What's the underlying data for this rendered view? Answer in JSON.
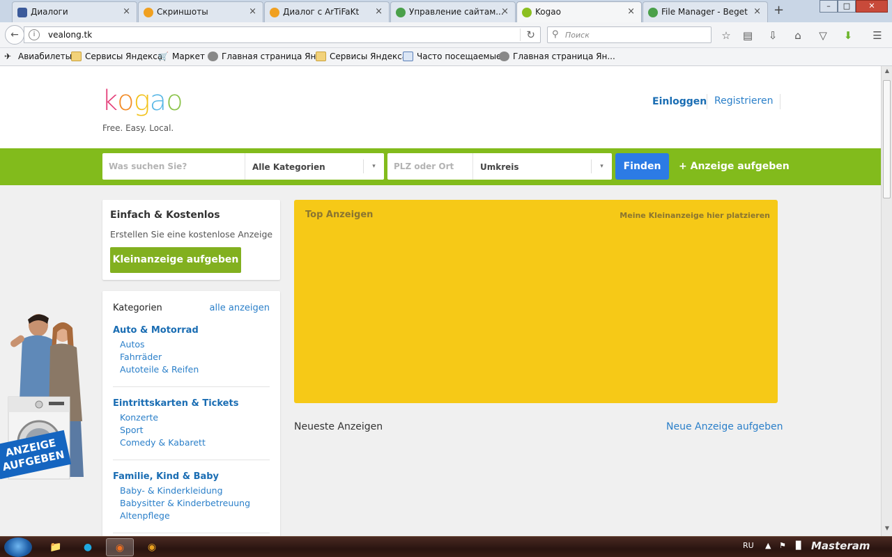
{
  "browser": {
    "tabs": [
      {
        "label": "Диалоги",
        "fav_color": "#3b5a9a",
        "active": false
      },
      {
        "label": "Скриншоты",
        "fav_color": "#f0a020",
        "active": false
      },
      {
        "label": "Диалог с ArTiFaKt",
        "fav_color": "#f0a020",
        "active": false
      },
      {
        "label": "Управление сайтам...",
        "fav_color": "#4aa04a",
        "active": false
      },
      {
        "label": "Kogao",
        "fav_color": "#8bbf20",
        "active": true
      },
      {
        "label": "File Manager - Beget",
        "fav_color": "#4aa04a",
        "active": false
      }
    ],
    "tab_close_glyph": "×",
    "new_tab_glyph": "+",
    "url": "vealong.tk",
    "search_placeholder": "Поиск",
    "bookmarks": [
      {
        "label": "Авиабилеты",
        "icon": "plane-icon"
      },
      {
        "label": "Сервисы Яндекса",
        "icon": "folder-icon"
      },
      {
        "label": "Маркет",
        "icon": "cart-icon"
      },
      {
        "label": "Главная страница Ян...",
        "icon": "globe-icon"
      },
      {
        "label": "Сервисы Яндекса",
        "icon": "folder-icon"
      },
      {
        "label": "Часто посещаемые",
        "icon": "folder-search-icon"
      },
      {
        "label": "Главная страница Ян...",
        "icon": "globe-icon"
      }
    ]
  },
  "site": {
    "logo_letters": [
      "k",
      "o",
      "g",
      "a",
      "o"
    ],
    "logo_colors": [
      "#e4407a",
      "#f28c28",
      "#f2c21a",
      "#5ab8e6",
      "#8bc34a"
    ],
    "tagline": "Free. Easy. Local.",
    "login_label": "Einloggen",
    "register_label": "Registrieren",
    "search": {
      "query_placeholder": "Was suchen Sie?",
      "category_value": "Alle Kategorien",
      "location_placeholder": "PLZ oder Ort",
      "radius_value": "Umkreis",
      "dropdown_glyph": "▾",
      "submit_label": "Finden",
      "add_label": "+ Anzeige aufgeben"
    },
    "promo_card": {
      "title": "Einfach & Kostenlos",
      "description": "Erstellen Sie eine kostenlose Anzeige",
      "button_label": "Kleinanzeige aufgeben"
    },
    "categories": {
      "heading": "Kategorien",
      "all_link": "alle anzeigen",
      "groups": [
        {
          "title": "Auto & Motorrad",
          "items": [
            "Autos",
            "Fahrräder",
            "Autoteile & Reifen"
          ]
        },
        {
          "title": "Eintrittskarten & Tickets",
          "items": [
            "Konzerte",
            "Sport",
            "Comedy & Kabarett"
          ]
        },
        {
          "title": "Familie, Kind & Baby",
          "items": [
            "Baby- & Kinderkleidung",
            "Babysitter & Kinderbetreuung",
            "Altenpflege"
          ]
        }
      ]
    },
    "top_ads": {
      "title": "Top Anzeigen",
      "link": "Meine Kleinanzeige hier platzieren",
      "bg_color": "#f6c917"
    },
    "newest_heading": "Neueste Anzeigen",
    "new_ad_link": "Neue Anzeige aufgeben",
    "promo_banner_text": [
      "ANZEIGE",
      "AUFGEBEN"
    ],
    "accent_green": "#82bb1c",
    "accent_blue": "#2c7be5"
  },
  "taskbar": {
    "lang": "RU",
    "watermark": "Masteram"
  }
}
